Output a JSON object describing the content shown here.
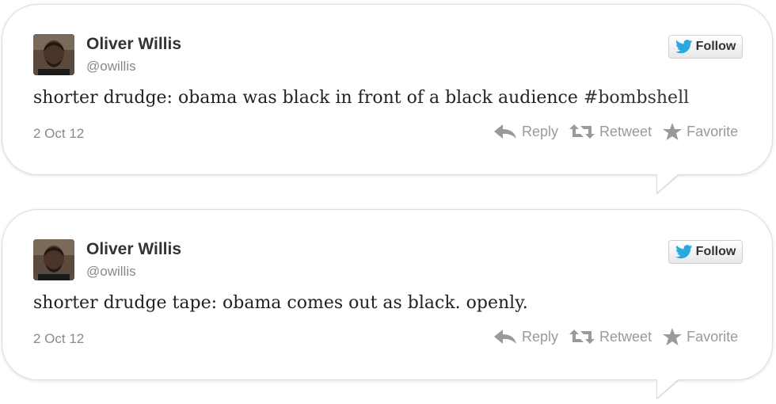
{
  "tweets": [
    {
      "author": {
        "name": "Oliver Willis",
        "handle": "@owillis"
      },
      "follow_label": "Follow",
      "text": "shorter drudge: obama was black in front of a black audience",
      "hashtag": "#bombshell",
      "date": "2 Oct 12",
      "actions": {
        "reply": "Reply",
        "retweet": "Retweet",
        "favorite": "Favorite"
      }
    },
    {
      "author": {
        "name": "Oliver Willis",
        "handle": "@owillis"
      },
      "follow_label": "Follow",
      "text": "shorter drudge tape: obama comes out as black. openly.",
      "hashtag": "",
      "date": "2 Oct 12",
      "actions": {
        "reply": "Reply",
        "retweet": "Retweet",
        "favorite": "Favorite"
      }
    }
  ],
  "icons": {
    "brand": "twitter-bird-icon",
    "reply": "reply-arrow-icon",
    "retweet": "retweet-icon",
    "favorite": "star-icon"
  },
  "colors": {
    "twitter_blue": "#2aa9e0",
    "action_gray": "#9a9a9a",
    "name_text": "#333333"
  }
}
